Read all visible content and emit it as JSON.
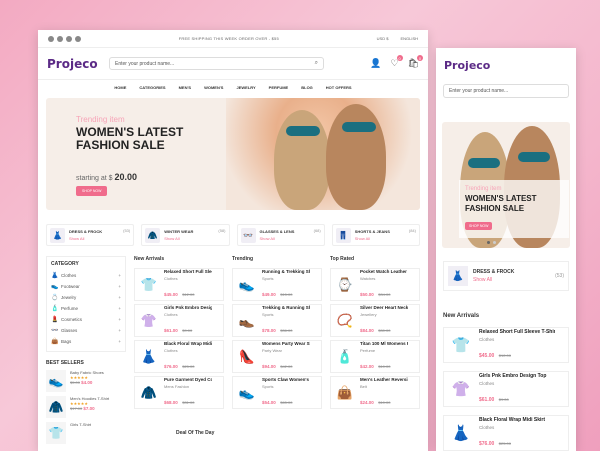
{
  "colors": {
    "brand": "#5b2a86",
    "accent": "#f06c8c",
    "background": "#f4b6cc"
  },
  "topbar": {
    "shipping": "FREE SHIPPING THIS WEEK ORDER OVER - $55",
    "currency": "USD $",
    "language": "ENGLISH",
    "social": [
      "facebook-icon",
      "twitter-icon",
      "instagram-icon",
      "linkedin-icon"
    ]
  },
  "header": {
    "logo": "Projeco",
    "search_placeholder": "Enter your product name...",
    "cart_count": "0",
    "wishlist_count": "0"
  },
  "nav": [
    "HOME",
    "CATEGORIES",
    "MEN'S",
    "WOMEN'S",
    "JEWELRY",
    "PERFUME",
    "BLOG",
    "HOT OFFERS"
  ],
  "hero": {
    "kicker": "Trending item",
    "title": "WOMEN'S LATEST FASHION SALE",
    "price_prefix": "starting at $",
    "price": "20.00",
    "button": "SHOP NOW"
  },
  "categories": [
    {
      "name": "DRESS & FROCK",
      "count": "(53)",
      "link": "Show All",
      "icon": "dress-icon",
      "glyph": "👗"
    },
    {
      "name": "WINTER WEAR",
      "count": "(58)",
      "link": "Show All",
      "icon": "coat-icon",
      "glyph": "🧥"
    },
    {
      "name": "GLASSES & LENS",
      "count": "(68)",
      "link": "Show All",
      "icon": "glasses-icon",
      "glyph": "👓"
    },
    {
      "name": "SHORTS & JEANS",
      "count": "(84)",
      "link": "Show All",
      "icon": "jeans-icon",
      "glyph": "👖"
    }
  ],
  "sidebar": {
    "title": "CATEGORY",
    "items": [
      {
        "label": "Clothes",
        "glyph": "👗"
      },
      {
        "label": "Footwear",
        "glyph": "👟"
      },
      {
        "label": "Jewelry",
        "glyph": "💍"
      },
      {
        "label": "Perfume",
        "glyph": "🧴"
      },
      {
        "label": "Cosmetics",
        "glyph": "💄"
      },
      {
        "label": "Glasses",
        "glyph": "👓"
      },
      {
        "label": "Bags",
        "glyph": "👜"
      }
    ],
    "bestsellers_title": "BEST SELLERS",
    "bestsellers": [
      {
        "name": "Baby Fabric Shoes",
        "price": "$4.00",
        "old": "$5.00",
        "glyph": "👟"
      },
      {
        "name": "Men's Hoodies T-Shirt",
        "price": "$7.00",
        "old": "$17.00",
        "glyph": "🧥"
      },
      {
        "name": "Girls T-Shirt",
        "price": "",
        "old": "",
        "glyph": "👕"
      }
    ]
  },
  "columns": [
    {
      "title": "New Arrivals",
      "items": [
        {
          "name": "Relaxed Short Full Sleeve",
          "cat": "Clothes",
          "price": "$45.00",
          "old": "$12.00",
          "glyph": "👕"
        },
        {
          "name": "Girls Pnk Embro Design Top",
          "cat": "Clothes",
          "price": "$61.00",
          "old": "$9.00",
          "glyph": "👚"
        },
        {
          "name": "Black Floral Wrap Midi Skirt",
          "cat": "Clothes",
          "price": "$76.00",
          "old": "$25.00",
          "glyph": "👗"
        },
        {
          "name": "Pure Garment Dyed Cotton",
          "cat": "Mens Fashion",
          "price": "$68.00",
          "old": "$31.00",
          "glyph": "🧥"
        }
      ]
    },
    {
      "title": "Trending",
      "items": [
        {
          "name": "Running & Trekking Shoe",
          "cat": "Sports",
          "price": "$49.00",
          "old": "$15.00",
          "glyph": "👟"
        },
        {
          "name": "Trekking & Running Shoes",
          "cat": "Sports",
          "price": "$78.00",
          "old": "$36.00",
          "glyph": "👞"
        },
        {
          "name": "Womens Party Wear Shoes",
          "cat": "Party Wear",
          "price": "$94.00",
          "old": "$42.00",
          "glyph": "👠"
        },
        {
          "name": "Sports Claw Women's Shoes",
          "cat": "Sports",
          "price": "$54.00",
          "old": "$65.00",
          "glyph": "👟"
        }
      ]
    },
    {
      "title": "Top Rated",
      "items": [
        {
          "name": "Pocket Watch Leather",
          "cat": "Watches",
          "price": "$50.00",
          "old": "$34.00",
          "glyph": "⌚"
        },
        {
          "name": "Silver Deer Heart Necklace",
          "cat": "Jewellery",
          "price": "$84.00",
          "old": "$30.00",
          "glyph": "📿"
        },
        {
          "name": "Titan 100 Ml Womens Perfume",
          "cat": "Perfume",
          "price": "$42.00",
          "old": "$10.00",
          "glyph": "🧴"
        },
        {
          "name": "Men's Leather Reversible Belt",
          "cat": "Belt",
          "price": "$24.00",
          "old": "$10.00",
          "glyph": "👜"
        }
      ]
    }
  ],
  "deal_title": "Deal Of The Day",
  "mobile": {
    "logo": "Projeco",
    "search_placeholder": "Enter your product name...",
    "hero_kicker": "Trending item",
    "hero_title": "WOMEN'S LATEST FASHION SALE",
    "hero_button": "SHOP NOW",
    "cat_name": "DRESS & FROCK",
    "cat_link": "Show All",
    "cat_count": "(53)",
    "new_title": "New Arrivals",
    "items": [
      {
        "name": "Relaxed Short Full Sleeve T-Shirt",
        "cat": "Clothes",
        "price": "$45.00",
        "old": "$12.00",
        "glyph": "👕"
      },
      {
        "name": "Girls Pnk Embro Design Top",
        "cat": "Clothes",
        "price": "$61.00",
        "old": "$9.00",
        "glyph": "👚"
      },
      {
        "name": "Black Floral Wrap Midi Skirt",
        "cat": "Clothes",
        "price": "$76.00",
        "old": "$25.00",
        "glyph": "👗"
      }
    ]
  }
}
